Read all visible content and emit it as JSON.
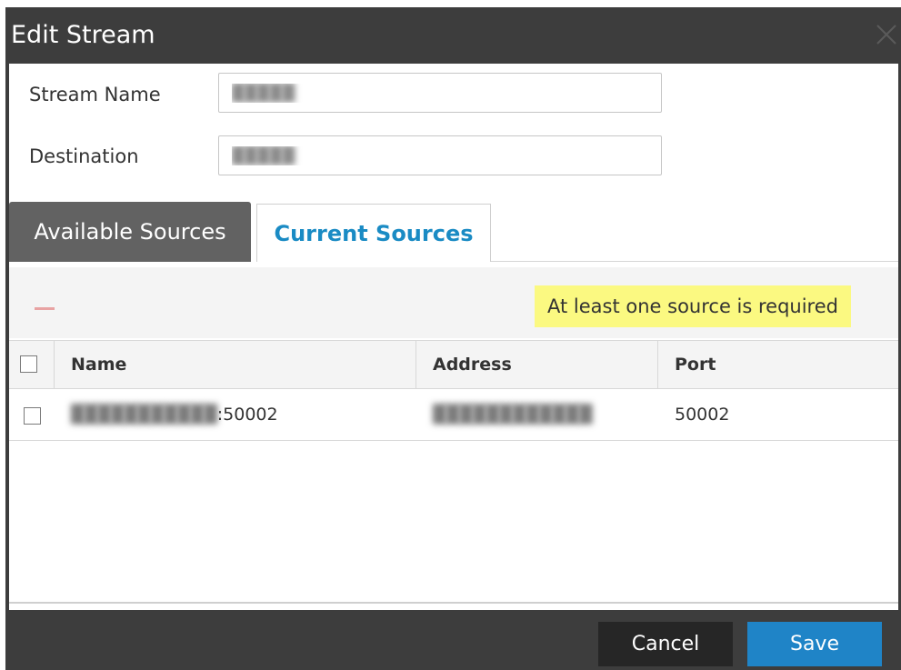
{
  "dialog": {
    "title": "Edit Stream"
  },
  "form": {
    "stream_name_label": "Stream Name",
    "stream_name_value": "█████",
    "destination_label": "Destination",
    "destination_value": "█████"
  },
  "tabs": [
    {
      "label": "Available Sources",
      "active": false
    },
    {
      "label": "Current Sources",
      "active": true
    }
  ],
  "toolbar": {
    "remove_icon": "minus-icon",
    "warning_text": "At least one source is required"
  },
  "table": {
    "columns": [
      "Name",
      "Address",
      "Port"
    ],
    "rows": [
      {
        "name_hidden": "███████████",
        "name_suffix": ":50002",
        "address_hidden": "████████████",
        "port": "50002"
      }
    ]
  },
  "footer": {
    "cancel_label": "Cancel",
    "save_label": "Save"
  },
  "colors": {
    "titlebar": "#3d3d3d",
    "accent": "#1f84c7",
    "active_tab_text": "#1a8bc4",
    "warning_bg": "#fbf981"
  }
}
